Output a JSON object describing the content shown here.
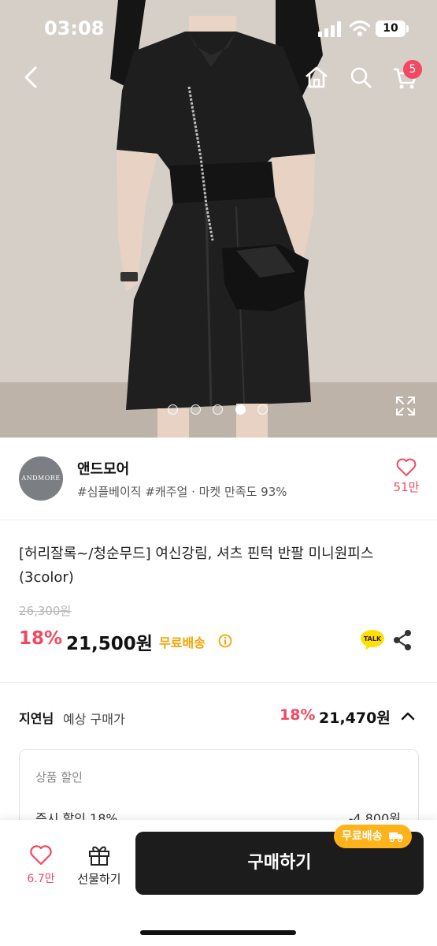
{
  "status_bar": {
    "time": "03:08",
    "battery": "10"
  },
  "header": {
    "cart_badge": "5"
  },
  "gallery": {
    "image_count": 5,
    "active_index": 3
  },
  "seller": {
    "logo_text": "ANDMORE",
    "name": "앤드모어",
    "tags": "#심플베이직 #캐주얼 · 마켓 만족도 93%",
    "like_count": "51만"
  },
  "product": {
    "title": "[허리잘록~/청순무드] 여신강림, 셔츠 핀턱 반팔 미니원피스 (3color)",
    "original_price": "26,300원",
    "discount_rate": "18%",
    "sale_price": "21,500원",
    "shipping": "무료배송",
    "talk_label": "TALK"
  },
  "expected": {
    "user_name": "지연님",
    "label": "예상 구매가",
    "rate": "18%",
    "price": "21,470원",
    "detail_header": "상품 할인",
    "detail_label": "즉시 할인 18%",
    "detail_value": "-4,800원"
  },
  "bottom_bar": {
    "wish_count": "6.7만",
    "gift_label": "선물하기",
    "buy_label": "구매하기",
    "ship_chip": "무료배송"
  },
  "colors": {
    "accent": "#f24862",
    "shipping": "#f5a300",
    "button": "#1c1c1c",
    "chip": "#ffb31a"
  }
}
